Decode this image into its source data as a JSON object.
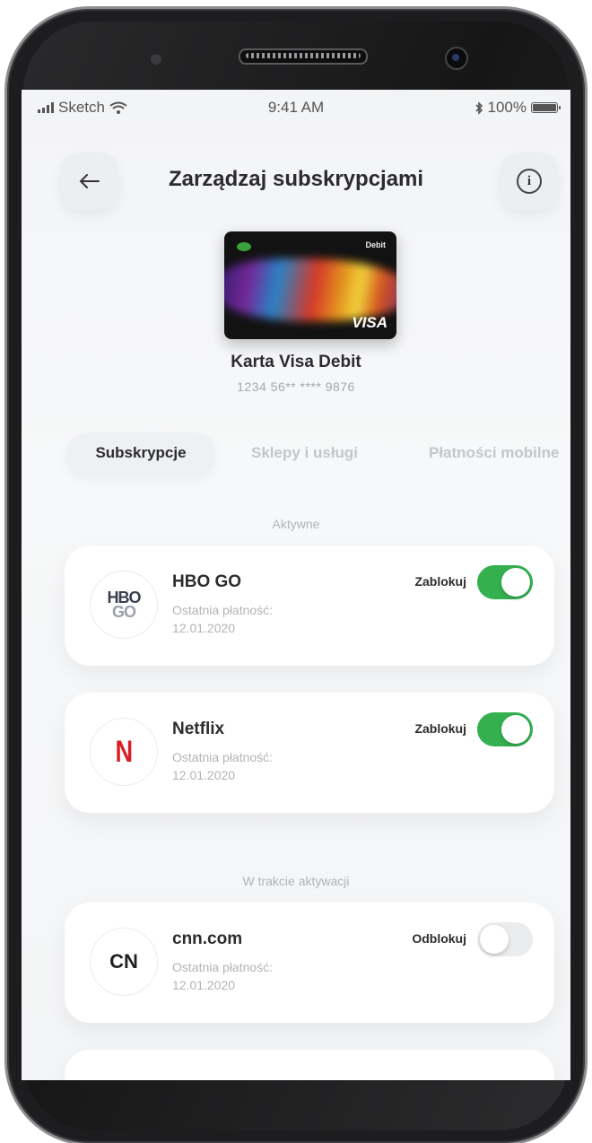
{
  "status_bar": {
    "carrier": "Sketch",
    "time": "9:41 AM",
    "battery": "100%"
  },
  "header": {
    "title": "Zarządzaj subskrypcjami",
    "back_icon": "arrow-left-icon",
    "info_icon": "info-icon"
  },
  "card": {
    "name": "Karta Visa Debit",
    "number": "1234 56** **** 9876",
    "type_label": "Debit",
    "brand": "VISA"
  },
  "tabs": [
    {
      "label": "Subskrypcje",
      "active": true
    },
    {
      "label": "Sklepy i usługi",
      "active": false
    },
    {
      "label": "Płatności mobilne",
      "active": false
    }
  ],
  "sections": {
    "active": "Aktywne",
    "pending": "W trakcie aktywacji"
  },
  "subscriptions": [
    {
      "name": "HBO GO",
      "last_payment_label": "Ostatnia płatność:",
      "date": "12.01.2020",
      "action": "Zablokuj",
      "toggle_on": true,
      "logo_text": "HBO",
      "logo_text2": "GO"
    },
    {
      "name": "Netflix",
      "last_payment_label": "Ostatnia płatność:",
      "date": "12.01.2020",
      "action": "Zablokuj",
      "toggle_on": true,
      "logo_text": "N"
    },
    {
      "name": "cnn.com",
      "last_payment_label": "Ostatnia płatność:",
      "date": "12.01.2020",
      "action": "Odblokuj",
      "toggle_on": false,
      "logo_text": "CN"
    }
  ],
  "colors": {
    "toggle_on": "#34b04f",
    "toggle_off": "#ebecee",
    "text_primary": "#2c2c2e",
    "text_muted": "#b2b4b8"
  }
}
